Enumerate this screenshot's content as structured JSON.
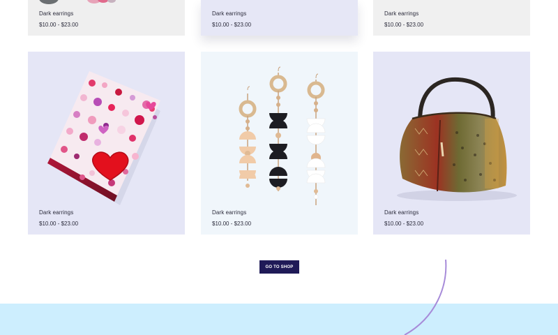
{
  "products": {
    "row1": [
      {
        "name": "Dark earrings",
        "price": "$10.00 - $23.00"
      },
      {
        "name": "Dark earrings",
        "price": "$10.00 - $23.00"
      },
      {
        "name": "Dark earrings",
        "price": "$10.00 - $23.00"
      }
    ],
    "row2": [
      {
        "name": "Dark earrings",
        "price": "$10.00 - $23.00",
        "image": "heart-mosaic-notebook"
      },
      {
        "name": "Dark earrings",
        "price": "$10.00 - $23.00",
        "image": "wooden-bead-earrings"
      },
      {
        "name": "Dark earrings",
        "price": "$10.00 - $23.00",
        "image": "patterned-handbag"
      }
    ]
  },
  "shop_button": {
    "label": "GO TO SHOP"
  },
  "colors": {
    "button": "#1f1a57",
    "footer_band": "#cdeefe",
    "accent_curve": "#a78bd9"
  }
}
